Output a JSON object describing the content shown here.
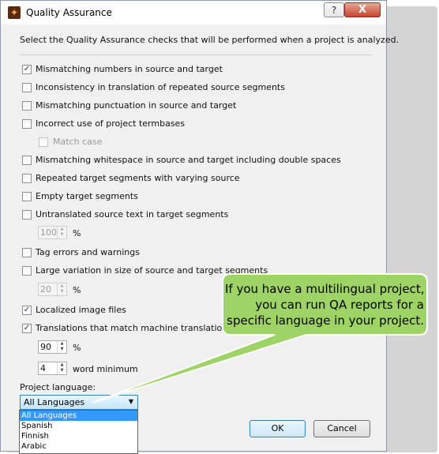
{
  "window": {
    "title": "Quality Assurance",
    "help_label": "?",
    "close_label": "X"
  },
  "intro": "Select the Quality Assurance checks that will be performed when a project is analyzed.",
  "checks": {
    "numbers": {
      "label": "Mismatching numbers in source and target",
      "checked": true
    },
    "repeated": {
      "label": "Inconsistency in translation of repeated source segments",
      "checked": false
    },
    "punctuation": {
      "label": "Mismatching punctuation in source and target",
      "checked": false
    },
    "termbases": {
      "label": "Incorrect use of project termbases",
      "checked": false
    },
    "match_case": {
      "label": "Match case",
      "checked": false,
      "disabled": true
    },
    "whitespace": {
      "label": "Mismatching whitespace in source and target including double spaces",
      "checked": false
    },
    "repeated_target": {
      "label": "Repeated target segments with varying source",
      "checked": false
    },
    "empty": {
      "label": "Empty target segments",
      "checked": false
    },
    "untranslated": {
      "label": "Untranslated source text in target segments",
      "checked": false
    },
    "untranslated_value": "100",
    "tags": {
      "label": "Tag errors and warnings",
      "checked": false
    },
    "size_variation": {
      "label": "Large variation in size of source and target segments",
      "checked": false
    },
    "size_value": "20",
    "images": {
      "label": "Localized image files",
      "checked": true
    },
    "mt": {
      "label": "Translations that match machine translation",
      "checked": true
    },
    "mt_percent": "90",
    "mt_words": "4"
  },
  "units": {
    "percent": "%",
    "word_minimum": "word minimum"
  },
  "project_language": {
    "label": "Project language:",
    "selected": "All Languages",
    "options": [
      "All Languages",
      "Spanish",
      "Finnish",
      "Arabic"
    ]
  },
  "buttons": {
    "ok": "OK",
    "cancel": "Cancel"
  },
  "callout": {
    "line1": "If you have a multilingual project,",
    "line2": "you can run QA reports for a",
    "line3": "specific language in your project."
  },
  "icons": {
    "check": "✓",
    "spin_up": "▲",
    "spin_down": "▼",
    "dropdown": "▼"
  },
  "colors": {
    "callout_fill": "#9ed366",
    "callout_border": "#ffffff",
    "selection": "#3399ff"
  }
}
